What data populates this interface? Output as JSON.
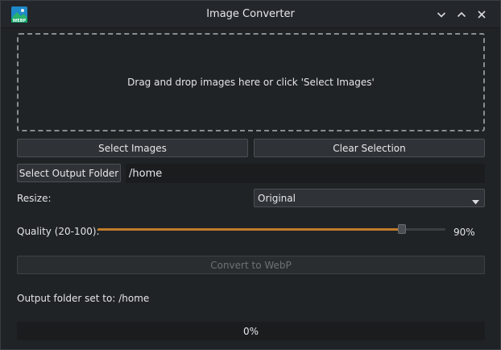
{
  "window": {
    "title": "Image Converter",
    "app_icon_label": "WEBP",
    "controls": [
      "minimize",
      "maximize",
      "close"
    ]
  },
  "drop_zone": {
    "text": "Drag and drop images here or click 'Select Images'"
  },
  "buttons": {
    "select_images": "Select Images",
    "clear_selection": "Clear Selection",
    "select_output_folder": "Select Output Folder",
    "convert": "Convert to WebP"
  },
  "output_folder": {
    "value": "/home"
  },
  "resize": {
    "label": "Resize:",
    "selected": "Original"
  },
  "quality": {
    "label": "Quality (20-100):",
    "min": 20,
    "max": 100,
    "value": 90,
    "value_text": "90%"
  },
  "status": {
    "text": "Output folder set to: /home"
  },
  "progress": {
    "value": 0,
    "text": "0%"
  },
  "colors": {
    "accent": "#c07c2a",
    "background": "#202326"
  }
}
